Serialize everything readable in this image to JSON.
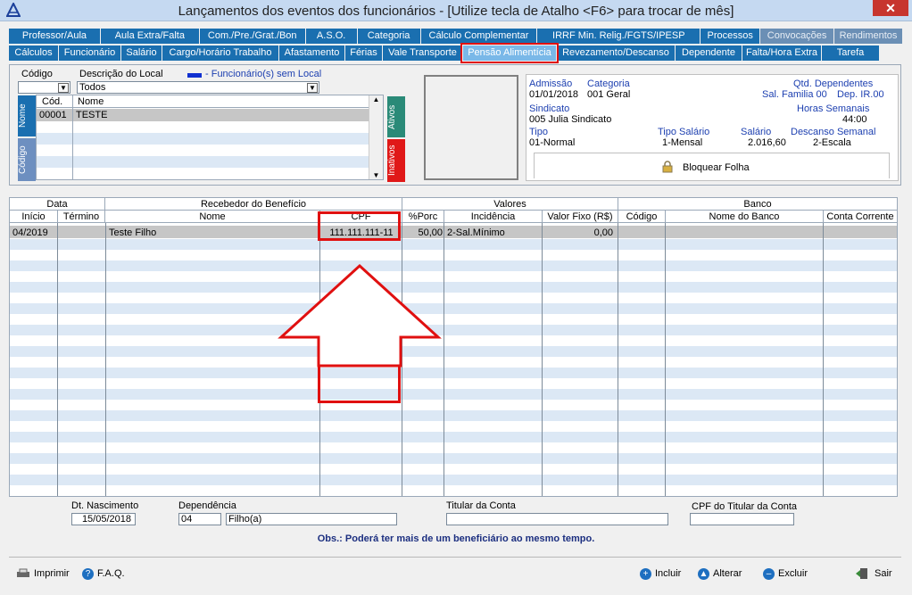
{
  "window": {
    "title": "Lançamentos dos eventos dos funcionários - [Utilize tecla de Atalho <F6> para trocar de mês]",
    "close": "✕"
  },
  "tabs_row1": [
    "Professor/Aula",
    "Aula Extra/Falta",
    "Com./Pre./Grat./Bon",
    "A.S.O.",
    "Categoria",
    "Cálculo Complementar",
    "IRRF Min. Relig./FGTS/IPESP",
    "Processos",
    "Convocações",
    "Rendimentos"
  ],
  "tabs_row2": [
    "Cálculos",
    "Funcionário",
    "Salário",
    "Cargo/Horário Trabalho",
    "Afastamento",
    "Férias",
    "Vale Transporte",
    "Pensão Alimentícia",
    "Revezamento/Descanso",
    "Dependente",
    "Falta/Hora Extra",
    "Tarefa"
  ],
  "filter": {
    "codigo_label": "Código",
    "descricao_label": "Descrição do Local",
    "descricao_value": "Todos",
    "legend": "- Funcionário(s) sem Local",
    "col_cod": "Cód.",
    "col_nome": "Nome",
    "row_cod": "00001",
    "row_nome": "TESTE",
    "tab_nome": "Nome",
    "tab_codigo": "Código",
    "tab_ativos": "Ativos",
    "tab_inativos": "Inativos"
  },
  "employee": {
    "admissao_label": "Admissão",
    "admissao": "01/01/2018",
    "categoria_label": "Categoria",
    "categoria": "001  Geral",
    "qtd_dep_label": "Qtd. Dependentes",
    "sal_familia": "Sal. Familia 00",
    "dep_ir": "Dep. IR.00",
    "sindicato_label": "Sindicato",
    "sindicato": "005  Julia Sindicato",
    "horas_label": "Horas Semanais",
    "horas": "44:00",
    "tipo_label": "Tipo",
    "tipo": "01-Normal",
    "tipo_salario_label": "Tipo Salário",
    "tipo_salario": "1-Mensal",
    "salario_label": "Salário",
    "salario": "2.016,60",
    "descanso_label": "Descanso Semanal",
    "descanso": "2-Escala",
    "bloquear": "Bloquear Folha"
  },
  "grid": {
    "group_data": "Data",
    "group_recebedor": "Recebedor do Benefício",
    "group_valores": "Valores",
    "group_banco": "Banco",
    "cols": {
      "inicio": "Início",
      "termino": "Término",
      "nome": "Nome",
      "cpf": "CPF",
      "porc": "%Porc",
      "incidencia": "Incidência",
      "valor_fixo": "Valor Fixo (R$)",
      "codigo": "Código",
      "nome_banco": "Nome do Banco",
      "conta": "Conta Corrente"
    },
    "row": {
      "inicio": "04/2019",
      "termino": "",
      "nome": "Teste Filho",
      "cpf": "111.111.111-11",
      "porc": "50,00",
      "incidencia": "2-Sal.Mínimo",
      "valor_fixo": "0,00",
      "codigo": "",
      "nome_banco": "",
      "conta": ""
    }
  },
  "details": {
    "dt_nasc_label": "Dt. Nascimento",
    "dt_nasc": "15/05/2018",
    "dependencia_label": "Dependência",
    "dependencia_cod": "04",
    "dependencia_desc": "Filho(a)",
    "titular_label": "Titular da Conta",
    "titular": "",
    "cpf_titular_label": "CPF do Titular da Conta",
    "cpf_titular": "",
    "obs": "Obs.: Poderá ter mais de um beneficiário ao mesmo tempo."
  },
  "footer": {
    "imprimir": "Imprimir",
    "faq": "F.A.Q.",
    "incluir": "Incluir",
    "alterar": "Alterar",
    "excluir": "Excluir",
    "sair": "Sair"
  },
  "colors": {
    "tab": "#1a6fb0",
    "highlight": "#e01010",
    "stripe": "#dce8f5"
  }
}
